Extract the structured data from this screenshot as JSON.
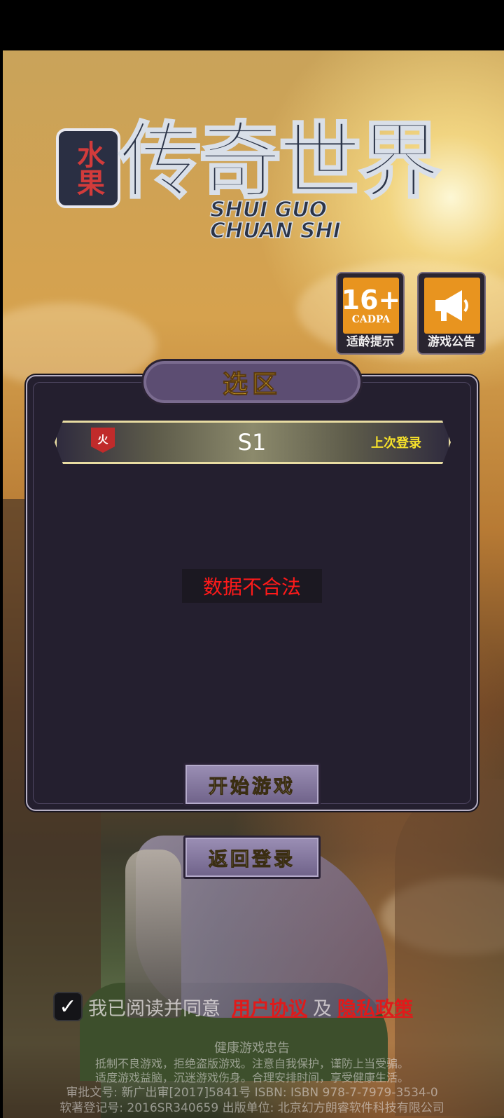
{
  "logo": {
    "badge": "水果",
    "title": "传奇世界",
    "subtitle_line1": "SHUI GUO",
    "subtitle_line2": "CHUAN SHI"
  },
  "side_buttons": {
    "age": {
      "num": "16+",
      "org": "CADPA",
      "label": "适龄提示"
    },
    "notice": {
      "label": "游戏公告",
      "icon": "megaphone-icon"
    }
  },
  "panel": {
    "title": "选区",
    "server": {
      "tag": "火",
      "name": "S1",
      "last_login": "上次登录"
    },
    "error": "数据不合法"
  },
  "buttons": {
    "start": "开始游戏",
    "back": "返回登录"
  },
  "agreement": {
    "checked": true,
    "prefix": "我已阅读并同意",
    "user_agreement": "用户协议",
    "and": "及",
    "privacy_policy": "隐私政策"
  },
  "footer": {
    "heading": "健康游戏忠告",
    "line1": "抵制不良游戏，拒绝盗版游戏。注意自我保护，谨防上当受骗。",
    "line2": "适度游戏益脑，沉迷游戏伤身。合理安排时间，享受健康生活。",
    "line3": "审批文号: 新广出审[2017]5841号 ISBN: ISBN 978-7-7979-3534-0",
    "line4": "软著登记号: 2016SR340659 出版单位: 北京幻方朗睿软件科技有限公司"
  },
  "colors": {
    "accent_gold": "#f3c02f",
    "error_red": "#ff1a1a",
    "panel_bg": "#241f2f",
    "age_tile": "#e8941f"
  }
}
